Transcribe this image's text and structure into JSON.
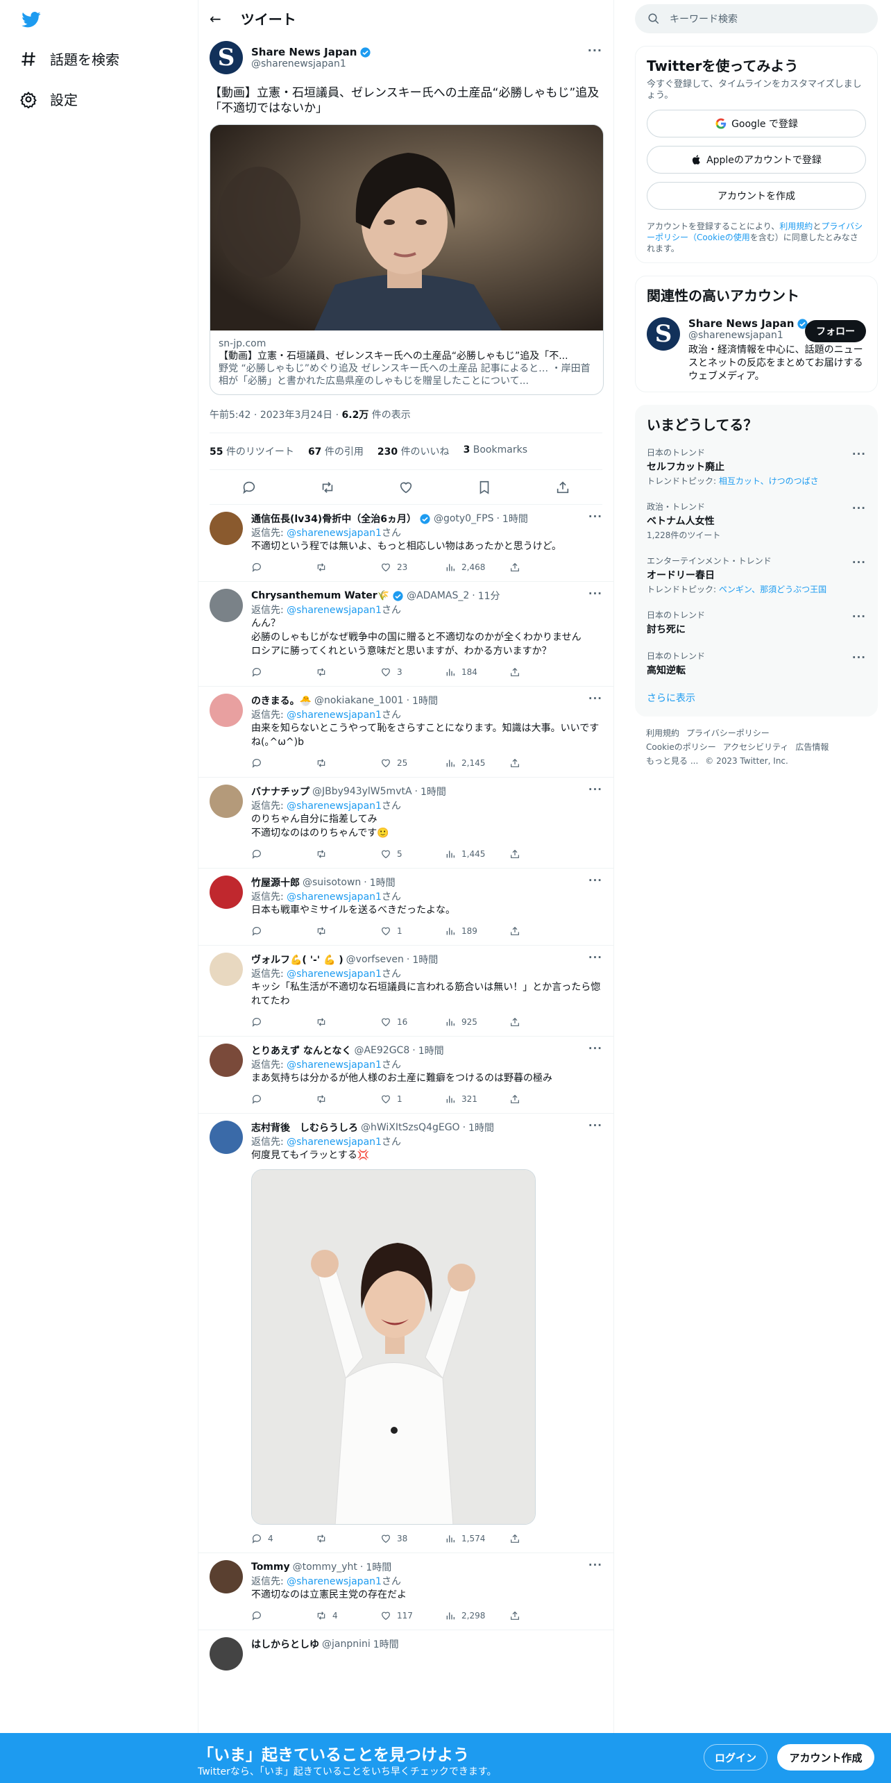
{
  "nav": {
    "explore": "話題を検索",
    "settings": "設定"
  },
  "header": {
    "title": "ツイート"
  },
  "tweet": {
    "display_name": "Share News Japan",
    "handle": "@sharenewsjapan1",
    "avatar_letter": "S",
    "text": "【動画】立憲・石垣議員、ゼレンスキー氏への土産品“必勝しゃもじ”追及「不適切ではないか」",
    "card": {
      "domain": "sn-jp.com",
      "title": "【動画】立憲・石垣議員、ゼレンスキー氏への土産品“必勝しゃもじ”追及「不...",
      "description": "野党 “必勝しゃもじ”めぐり追及 ゼレンスキー氏への土産品 記事によると… ・岸田首相が「必勝」と書かれた広島県産のしゃもじを贈呈したことについて..."
    },
    "time": "午前5:42",
    "date": "2023年3月24日",
    "views_count": "6.2万",
    "views_label": "件の表示",
    "retweets": "55",
    "retweets_label": "件のリツイート",
    "quotes": "67",
    "quotes_label": "件の引用",
    "likes": "230",
    "likes_label": "件のいいね",
    "bookmarks": "3",
    "bookmarks_label": "Bookmarks"
  },
  "reply_to_label": "返信先: ",
  "reply_to_handle": "@sharenewsjapan1",
  "reply_to_suffix": "さん",
  "replies": [
    {
      "name": "通信伍長(lv34)骨折中（全治6ヵ月）",
      "handle": "@goty0_FPS",
      "time": "1時間",
      "verified": true,
      "text": "不適切という程では無いよ、もっと相応しい物はあったかと思うけど。",
      "replies": "",
      "retweets": "",
      "likes": "23",
      "views": "2,468",
      "avatar_color": "#8a5a2e"
    },
    {
      "name": "Chrysanthemum Water🌾",
      "handle": "@ADAMAS_2",
      "time": "11分",
      "verified": true,
      "text": "んん？\n必勝のしゃもじがなぜ戦争中の国に贈ると不適切なのかが全くわかりません\nロシアに勝ってくれという意味だと思いますが、わかる方いますか？",
      "replies": "",
      "retweets": "",
      "likes": "3",
      "views": "184",
      "avatar_color": "#7a8288"
    },
    {
      "name": "のきまる。🐣",
      "handle": "@nokiakane_1001",
      "time": "1時間",
      "verified": false,
      "text": "由来を知らないとこうやって恥をさらすことになります。知識は大事。いいですね(｡^ω^)b",
      "replies": "",
      "retweets": "",
      "likes": "25",
      "views": "2,145",
      "avatar_color": "#e8a0a0"
    },
    {
      "name": "バナナチップ",
      "handle": "@JBby943ylW5mvtA",
      "time": "1時間",
      "verified": false,
      "text": "のりちゃん自分に指差してみ\n不適切なのはのりちゃんです🙂",
      "replies": "",
      "retweets": "",
      "likes": "5",
      "views": "1,445",
      "avatar_color": "#b49a7a"
    },
    {
      "name": "竹屋源十郎",
      "handle": "@suisotown",
      "time": "1時間",
      "verified": false,
      "text": "日本も戦車やミサイルを送るべきだったよな。",
      "replies": "",
      "retweets": "",
      "likes": "1",
      "views": "189",
      "avatar_color": "#c0282e"
    },
    {
      "name": "ヴォルフ💪( '-' 💪 )",
      "handle": "@vorfseven",
      "time": "1時間",
      "verified": false,
      "text": "キッシ「私生活が不適切な石垣議員に言われる筋合いは無い！」とか言ったら惚れてたわ",
      "replies": "",
      "retweets": "",
      "likes": "16",
      "views": "925",
      "avatar_color": "#e8d8c0"
    },
    {
      "name": "とりあえず なんとなく",
      "handle": "@AE92GC8",
      "time": "1時間",
      "verified": false,
      "text": "まあ気持ちは分かるが他人様のお土産に難癖をつけるのは野暮の極み",
      "replies": "",
      "retweets": "",
      "likes": "1",
      "views": "321",
      "avatar_color": "#7a4a3a"
    },
    {
      "name": "志村背後　しむらうしろ",
      "handle": "@hWiXItSzsQ4gEGO",
      "time": "1時間",
      "verified": false,
      "text": "何度見てもイラッとする💢",
      "replies": "4",
      "retweets": "",
      "likes": "38",
      "views": "1,574",
      "avatar_color": "#3a6aa8",
      "has_image": true
    },
    {
      "name": "Tommy",
      "handle": "@tommy_yht",
      "time": "1時間",
      "verified": false,
      "text": "不適切なのは立憲民主党の存在だよ",
      "replies": "",
      "retweets": "4",
      "likes": "117",
      "views": "2,298",
      "avatar_color": "#5a4030"
    }
  ],
  "sidebar": {
    "search_placeholder": "キーワード検索",
    "signup": {
      "title": "Twitterを使ってみよう",
      "subtitle": "今すぐ登録して、タイムラインをカスタマイズしましょう。",
      "google": "Google で登録",
      "apple": "Appleのアカウントで登録",
      "create": "アカウントを作成",
      "legal_1": "アカウントを登録することにより、",
      "legal_terms": "利用規約",
      "legal_2": "と",
      "legal_privacy": "プライバシーポリシー（Cookieの使用",
      "legal_3": "を含む）に同意したとみなされます。"
    },
    "related": {
      "title": "関連性の高いアカウント",
      "name": "Share News Japan",
      "handle": "@sharenewsjapan1",
      "follow": "フォロー",
      "bio": "政治・経済情報を中心に、話題のニュースとネットの反応をまとめてお届けするウェブメディア。"
    },
    "trends": {
      "title": "いまどうしてる？",
      "items": [
        {
          "category": "日本のトレンド",
          "topic": "セルフカット廃止",
          "extra_prefix": "トレンドトピック: ",
          "extra": "相互カット、けつのつばさ"
        },
        {
          "category": "政治・トレンド",
          "topic": "ベトナム人女性",
          "extra_prefix": "",
          "extra": "1,228件のツイート"
        },
        {
          "category": "エンターテインメント・トレンド",
          "topic": "オードリー春日",
          "extra_prefix": "トレンドトピック: ",
          "extra": "ペンギン、那須どうぶつ王国"
        },
        {
          "category": "日本のトレンド",
          "topic": "討ち死に",
          "extra_prefix": "",
          "extra": ""
        },
        {
          "category": "日本のトレンド",
          "topic": "高知逆転",
          "extra_prefix": "",
          "extra": ""
        }
      ],
      "show_more": "さらに表示"
    },
    "footer": {
      "terms": "利用規約",
      "privacy": "プライバシーポリシー",
      "cookie": "Cookieのポリシー",
      "accessibility": "アクセシビリティ",
      "ads": "広告情報",
      "more": "もっと見る ...",
      "copyright": "© 2023 Twitter, Inc."
    }
  },
  "bottom_bar": {
    "title": "「いま」起きていることを見つけよう",
    "subtitle": "Twitterなら、「いま」起きていることをいち早くチェックできます。",
    "login": "ログイン",
    "signup": "アカウント作成"
  },
  "colors": {
    "accent": "#1d9bf0",
    "text": "#0f1419",
    "muted": "#536471",
    "border": "#eff3f4"
  },
  "partial_next_reply": {
    "name": "はしからとしゆ",
    "handle": "@janpnini",
    "time": "1時間"
  }
}
